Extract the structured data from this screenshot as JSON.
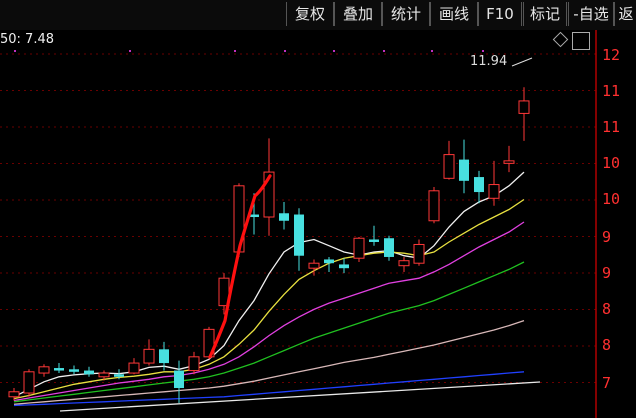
{
  "toolbar": {
    "items": [
      "复权",
      "叠加",
      "统计",
      "画线",
      "F10",
      "标记",
      "-自选",
      "返"
    ]
  },
  "readout": {
    "text": "50: 7.48"
  },
  "price_tag": {
    "text": "11.94"
  },
  "axis": {
    "labels": [
      "12",
      "11",
      "11",
      "10",
      "10",
      "9",
      "9",
      "8",
      "8",
      "7"
    ]
  },
  "colors": {
    "bg": "#000000",
    "up": "#ff3838",
    "down": "#48e0e0",
    "ma_white": "#f0f0f0",
    "ma_yellow": "#e8e040",
    "ma_magenta": "#e040e0",
    "ma_green": "#20c020",
    "ma_pinkgray": "#d8b8b8",
    "ma_blue": "#2040ff",
    "annotation": "#ff1010"
  },
  "chart_data": {
    "type": "candlestick",
    "y_range": [
      6.8,
      12.6
    ],
    "candles": [
      {
        "o": 6.98,
        "h": 7.12,
        "l": 6.92,
        "c": 7.06
      },
      {
        "o": 7.04,
        "h": 7.42,
        "l": 6.98,
        "c": 7.38
      },
      {
        "o": 7.36,
        "h": 7.5,
        "l": 7.3,
        "c": 7.46
      },
      {
        "o": 7.44,
        "h": 7.52,
        "l": 7.36,
        "c": 7.4
      },
      {
        "o": 7.42,
        "h": 7.48,
        "l": 7.34,
        "c": 7.38
      },
      {
        "o": 7.4,
        "h": 7.46,
        "l": 7.3,
        "c": 7.34
      },
      {
        "o": 7.3,
        "h": 7.4,
        "l": 7.24,
        "c": 7.36
      },
      {
        "o": 7.34,
        "h": 7.42,
        "l": 7.26,
        "c": 7.3
      },
      {
        "o": 7.36,
        "h": 7.6,
        "l": 7.34,
        "c": 7.52
      },
      {
        "o": 7.52,
        "h": 7.9,
        "l": 7.48,
        "c": 7.74
      },
      {
        "o": 7.74,
        "h": 7.86,
        "l": 7.4,
        "c": 7.52
      },
      {
        "o": 7.4,
        "h": 7.56,
        "l": 6.88,
        "c": 7.12
      },
      {
        "o": 7.4,
        "h": 7.7,
        "l": 7.34,
        "c": 7.62
      },
      {
        "o": 7.62,
        "h": 8.1,
        "l": 7.58,
        "c": 8.06
      },
      {
        "o": 8.44,
        "h": 8.96,
        "l": 8.3,
        "c": 8.88
      },
      {
        "o": 9.3,
        "h": 10.4,
        "l": 9.22,
        "c": 10.36
      },
      {
        "o": 9.9,
        "h": 10.24,
        "l": 9.58,
        "c": 9.86
      },
      {
        "o": 9.86,
        "h": 11.12,
        "l": 9.56,
        "c": 10.58
      },
      {
        "o": 9.92,
        "h": 10.1,
        "l": 9.66,
        "c": 9.8
      },
      {
        "o": 9.9,
        "h": 10.0,
        "l": 9.0,
        "c": 9.24
      },
      {
        "o": 9.04,
        "h": 9.18,
        "l": 8.92,
        "c": 9.12
      },
      {
        "o": 9.18,
        "h": 9.22,
        "l": 8.98,
        "c": 9.12
      },
      {
        "o": 9.1,
        "h": 9.2,
        "l": 8.96,
        "c": 9.04
      },
      {
        "o": 9.2,
        "h": 9.54,
        "l": 9.14,
        "c": 9.52
      },
      {
        "o": 9.5,
        "h": 9.72,
        "l": 9.4,
        "c": 9.46
      },
      {
        "o": 9.52,
        "h": 9.56,
        "l": 9.16,
        "c": 9.22
      },
      {
        "o": 9.08,
        "h": 9.22,
        "l": 8.98,
        "c": 9.16
      },
      {
        "o": 9.12,
        "h": 9.5,
        "l": 9.08,
        "c": 9.42
      },
      {
        "o": 9.8,
        "h": 10.34,
        "l": 9.76,
        "c": 10.28
      },
      {
        "o": 10.48,
        "h": 11.08,
        "l": 10.46,
        "c": 10.86
      },
      {
        "o": 10.78,
        "h": 11.1,
        "l": 10.24,
        "c": 10.44
      },
      {
        "o": 10.5,
        "h": 10.6,
        "l": 10.08,
        "c": 10.26
      },
      {
        "o": 10.16,
        "h": 10.76,
        "l": 10.04,
        "c": 10.38
      },
      {
        "o": 10.72,
        "h": 11.0,
        "l": 10.58,
        "c": 10.76
      },
      {
        "o": 11.52,
        "h": 11.94,
        "l": 11.08,
        "c": 11.72
      }
    ],
    "moving_averages": [
      {
        "color_key": "ma_white",
        "values": [
          6.98,
          7.1,
          7.22,
          7.3,
          7.33,
          7.35,
          7.36,
          7.35,
          7.38,
          7.45,
          7.47,
          7.42,
          7.48,
          7.58,
          7.8,
          8.2,
          8.52,
          8.95,
          9.3,
          9.45,
          9.5,
          9.4,
          9.3,
          9.25,
          9.3,
          9.32,
          9.24,
          9.2,
          9.4,
          9.7,
          9.95,
          10.1,
          10.2,
          10.36,
          10.58
        ]
      },
      {
        "color_key": "ma_yellow",
        "values": [
          6.95,
          7.0,
          7.06,
          7.12,
          7.18,
          7.22,
          7.26,
          7.29,
          7.31,
          7.34,
          7.38,
          7.38,
          7.42,
          7.5,
          7.62,
          7.82,
          8.05,
          8.35,
          8.62,
          8.86,
          9.0,
          9.12,
          9.2,
          9.24,
          9.28,
          9.3,
          9.28,
          9.24,
          9.3,
          9.46,
          9.6,
          9.74,
          9.86,
          9.98,
          10.14
        ]
      },
      {
        "color_key": "ma_magenta",
        "values": [
          6.92,
          6.96,
          7.0,
          7.04,
          7.08,
          7.12,
          7.16,
          7.2,
          7.23,
          7.26,
          7.3,
          7.32,
          7.36,
          7.42,
          7.5,
          7.62,
          7.78,
          7.96,
          8.12,
          8.26,
          8.38,
          8.48,
          8.56,
          8.64,
          8.72,
          8.8,
          8.84,
          8.88,
          8.98,
          9.1,
          9.24,
          9.38,
          9.5,
          9.62,
          9.78
        ]
      },
      {
        "color_key": "ma_green",
        "values": [
          6.9,
          6.93,
          6.96,
          6.99,
          7.02,
          7.05,
          7.08,
          7.11,
          7.14,
          7.17,
          7.2,
          7.23,
          7.26,
          7.3,
          7.36,
          7.44,
          7.52,
          7.62,
          7.72,
          7.82,
          7.92,
          8.0,
          8.08,
          8.16,
          8.24,
          8.32,
          8.38,
          8.44,
          8.52,
          8.62,
          8.72,
          8.82,
          8.92,
          9.02,
          9.14
        ]
      },
      {
        "color_key": "ma_pinkgray",
        "values": [
          6.86,
          6.88,
          6.9,
          6.92,
          6.94,
          6.96,
          6.98,
          7.0,
          7.02,
          7.04,
          7.06,
          7.08,
          7.1,
          7.12,
          7.15,
          7.19,
          7.23,
          7.28,
          7.33,
          7.38,
          7.43,
          7.48,
          7.53,
          7.57,
          7.61,
          7.66,
          7.71,
          7.76,
          7.81,
          7.87,
          7.93,
          7.99,
          8.05,
          8.12,
          8.2
        ]
      },
      {
        "color_key": "ma_blue",
        "values": [
          6.84,
          6.85,
          6.86,
          6.87,
          6.88,
          6.89,
          6.9,
          6.91,
          6.92,
          6.93,
          6.94,
          6.95,
          6.96,
          6.97,
          6.98,
          7.0,
          7.02,
          7.04,
          7.06,
          7.08,
          7.1,
          7.12,
          7.14,
          7.16,
          7.18,
          7.2,
          7.22,
          7.24,
          7.26,
          7.28,
          7.3,
          7.32,
          7.34,
          7.36,
          7.38
        ]
      }
    ],
    "annotation_curve": [
      [
        13,
        7.62
      ],
      [
        14,
        8.2
      ],
      [
        15,
        9.4
      ],
      [
        16,
        10.2
      ],
      [
        17,
        10.52
      ]
    ]
  }
}
